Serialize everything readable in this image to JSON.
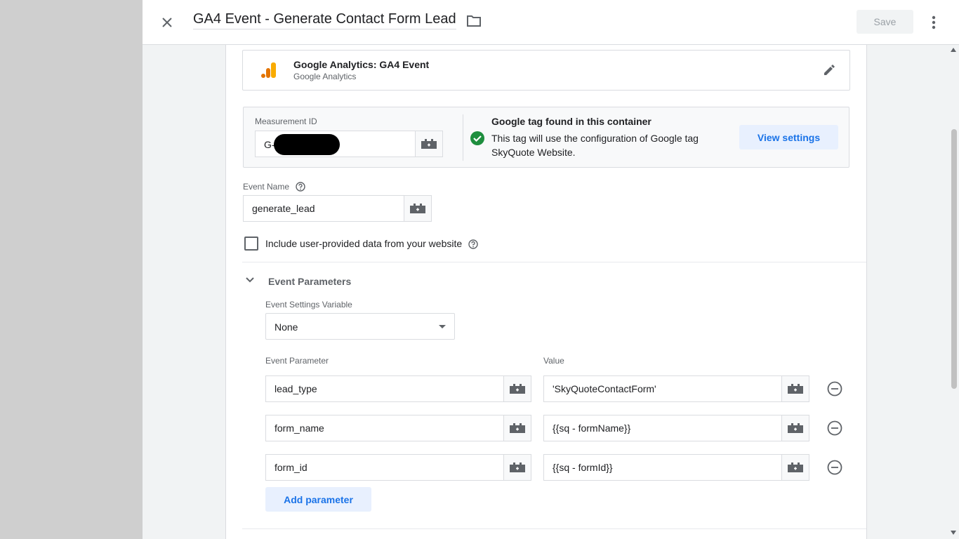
{
  "header": {
    "title": "GA4 Event - Generate Contact Form Lead",
    "save_label": "Save"
  },
  "tag_type": {
    "name": "Google Analytics: GA4 Event",
    "provider": "Google Analytics"
  },
  "measurement": {
    "label": "Measurement ID",
    "value": "G-",
    "notice_title": "Google tag found in this container",
    "notice_text": "This tag will use the configuration of Google tag SkyQuote Website.",
    "view_settings_label": "View settings"
  },
  "event_name": {
    "label": "Event Name",
    "value": "generate_lead"
  },
  "user_data": {
    "label": "Include user-provided data from your website",
    "checked": false
  },
  "event_parameters": {
    "section_title": "Event Parameters",
    "settings_variable_label": "Event Settings Variable",
    "settings_variable_value": "None",
    "param_col_label": "Event Parameter",
    "value_col_label": "Value",
    "rows": [
      {
        "param": "lead_type",
        "value": "'SkyQuoteContactForm'"
      },
      {
        "param": "form_name",
        "value": "{{sq - formName}}"
      },
      {
        "param": "form_id",
        "value": "{{sq - formId}}"
      }
    ],
    "add_label": "Add parameter"
  },
  "colors": {
    "accent": "#1a73e8",
    "success": "#1e8e3e",
    "analytics_orange": "#f9ab00",
    "analytics_dark": "#e37400"
  }
}
